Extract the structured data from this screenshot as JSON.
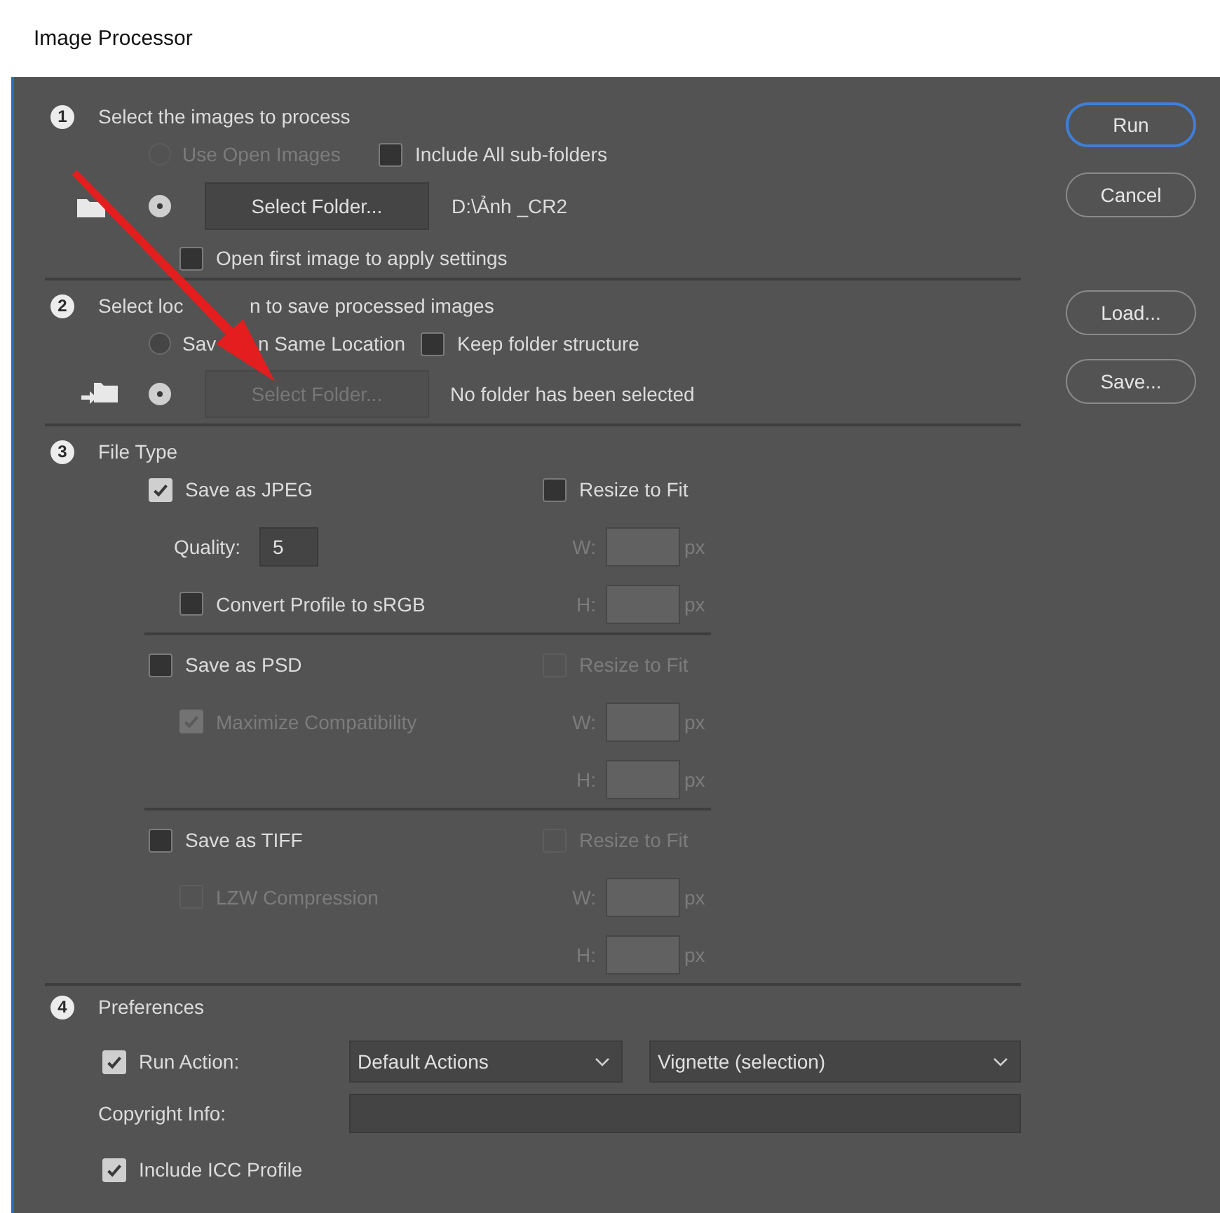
{
  "window": {
    "title": "Image Processor"
  },
  "source": {
    "number": "1",
    "title": "Select the images to process",
    "use_open_images": {
      "label": "Use Open Images",
      "selected": false,
      "disabled": true
    },
    "include_subfolders": {
      "label": "Include All sub-folders",
      "checked": false
    },
    "folder": {
      "selected": true,
      "button": "Select Folder...",
      "disabled": false,
      "path": "D:\\Ảnh _CR2"
    },
    "open_first_image": {
      "label": "Open first image to apply settings",
      "checked": false
    }
  },
  "destination": {
    "number": "2",
    "title_parts": [
      "Select loc",
      "n to save processed images"
    ],
    "same_location": {
      "label_parts": [
        "Sav",
        "n Same Location"
      ],
      "selected": false
    },
    "keep_structure": {
      "label": "Keep folder structure",
      "checked": false
    },
    "folder": {
      "selected": true,
      "button": "Select Folder...",
      "disabled": true,
      "status": "No folder has been selected"
    }
  },
  "file_type": {
    "number": "3",
    "title": "File Type",
    "formats": [
      {
        "save": {
          "label": "Save as JPEG",
          "checked": true
        },
        "quality": {
          "label": "Quality:",
          "value": "5"
        },
        "option": {
          "label": "Convert Profile to sRGB",
          "checked": false,
          "disabled": false
        },
        "resize": {
          "label": "Resize to Fit",
          "checked": false,
          "disabled": false
        },
        "width": {
          "label": "W:",
          "unit": "px",
          "disabled": true
        },
        "height": {
          "label": "H:",
          "unit": "px",
          "disabled": true
        }
      },
      {
        "save": {
          "label": "Save as PSD",
          "checked": false
        },
        "option": {
          "label": "Maximize Compatibility",
          "checked": true,
          "disabled": true
        },
        "resize": {
          "label": "Resize to Fit",
          "checked": false,
          "disabled": true
        },
        "width": {
          "label": "W:",
          "unit": "px",
          "disabled": true
        },
        "height": {
          "label": "H:",
          "unit": "px",
          "disabled": true
        }
      },
      {
        "save": {
          "label": "Save as TIFF",
          "checked": false
        },
        "option": {
          "label": "LZW Compression",
          "checked": false,
          "disabled": true
        },
        "resize": {
          "label": "Resize to Fit",
          "checked": false,
          "disabled": true
        },
        "width": {
          "label": "W:",
          "unit": "px",
          "disabled": true
        },
        "height": {
          "label": "H:",
          "unit": "px",
          "disabled": true
        }
      }
    ]
  },
  "preferences": {
    "number": "4",
    "title": "Preferences",
    "run_action": {
      "label": "Run Action:",
      "checked": true,
      "action_set": "Default Actions",
      "action": "Vignette (selection)"
    },
    "copyright": {
      "label": "Copyright Info:"
    },
    "include_icc": {
      "label": "Include ICC Profile",
      "checked": true
    }
  },
  "buttons": [
    {
      "label": "Run",
      "default": true
    },
    {
      "label": "Cancel",
      "default": false
    }
  ],
  "settings_buttons": [
    {
      "label": "Load..."
    },
    {
      "label": "Save..."
    }
  ]
}
